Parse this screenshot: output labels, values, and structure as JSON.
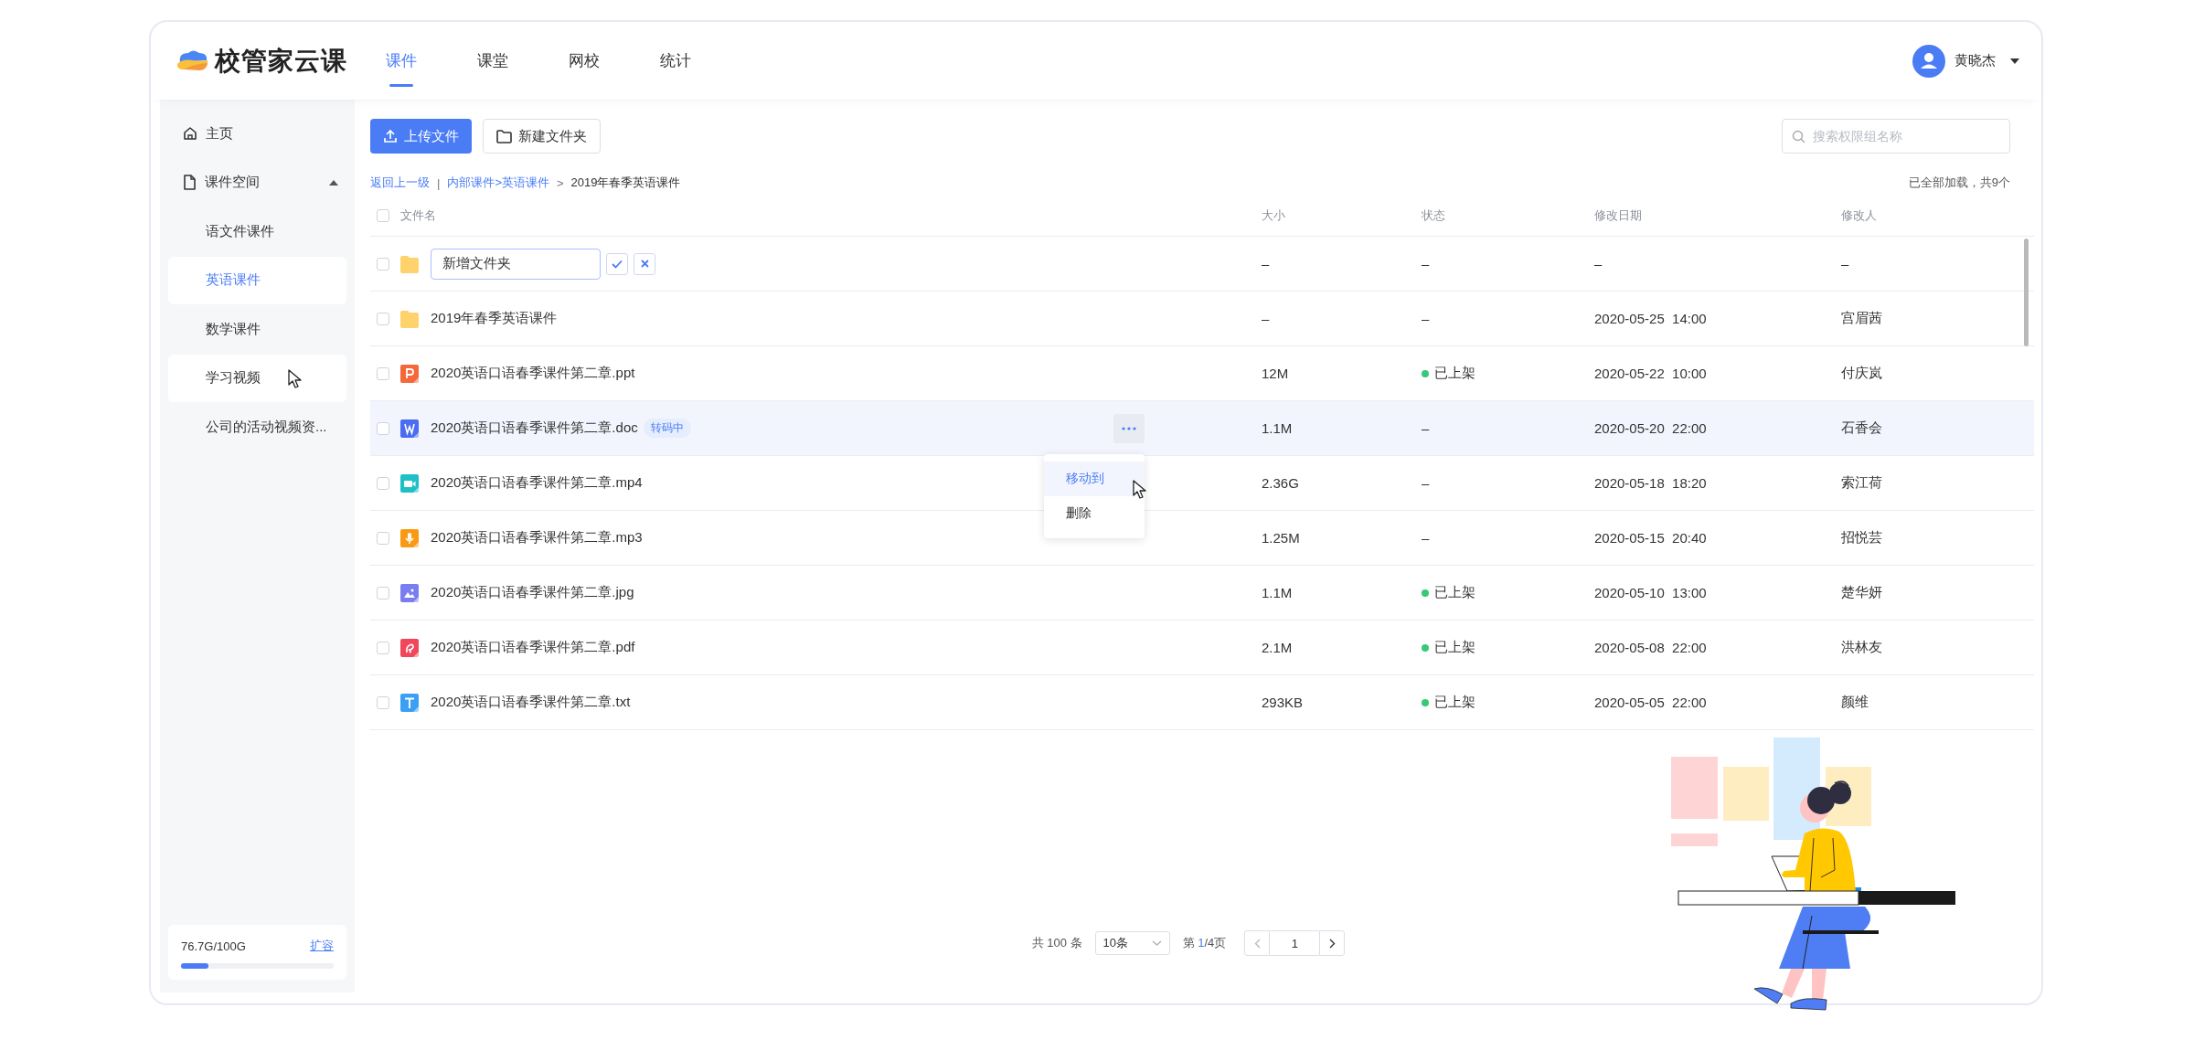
{
  "logo": {
    "text": "校管家云课"
  },
  "nav_tabs": [
    {
      "label": "课件",
      "selected": true
    },
    {
      "label": "课堂",
      "selected": false
    },
    {
      "label": "网校",
      "selected": false
    },
    {
      "label": "统计",
      "selected": false
    }
  ],
  "user": {
    "name": "黄晓杰"
  },
  "sidebar": {
    "items": [
      {
        "label": "主页",
        "selected": false
      },
      {
        "label": "课件空间",
        "selected": false,
        "expanded": true,
        "children": [
          {
            "label": "语文件课件",
            "selected": false,
            "hovered": false
          },
          {
            "label": "英语课件",
            "selected": true,
            "hovered": false
          },
          {
            "label": "数学课件",
            "selected": false,
            "hovered": false
          },
          {
            "label": "学习视频",
            "selected": false,
            "hovered": true
          },
          {
            "label": "公司的活动视频资...",
            "selected": false,
            "hovered": false
          }
        ]
      }
    ],
    "storage": {
      "usage": "76.7G/100G",
      "level": 0.18,
      "action": "扩容"
    }
  },
  "toolbar": {
    "buttons": [
      {
        "label": "上传文件",
        "kind": "primary"
      },
      {
        "label": "新建文件夹",
        "kind": "default"
      }
    ],
    "search": {
      "placeholder": "搜索权限组名称"
    }
  },
  "breadcrumb": {
    "back": "返回上一级",
    "separator": "|",
    "path": "内部课件>英语课件",
    "arrow": ">",
    "current": "2019年春季英语课件"
  },
  "load_status": "已全部加载，共9个",
  "table": {
    "all_checked": false,
    "columns": [
      "文件名",
      "大小",
      "状态",
      "修改日期",
      "修改人"
    ],
    "rows": [
      {
        "kind": "new-folder",
        "name": "新增文件夹",
        "size": "–",
        "status": "–",
        "published": false,
        "modified": "–",
        "editor": "–",
        "checked": false,
        "hovered": false
      },
      {
        "kind": "folder",
        "name": "2019年春季英语课件",
        "size": "–",
        "status": "–",
        "published": false,
        "modified": "2020-05-25  14:00",
        "editor": "宫眉茜",
        "checked": false,
        "hovered": false
      },
      {
        "kind": "ppt",
        "name": "2020英语口语春季课件第二章.ppt",
        "size": "12M",
        "status": "已上架",
        "published": true,
        "modified": "2020-05-22  10:00",
        "editor": "付庆岚",
        "checked": false,
        "hovered": false
      },
      {
        "kind": "doc",
        "name": "2020英语口语春季课件第二章.doc",
        "tag": "转码中",
        "size": "1.1M",
        "status": "–",
        "published": false,
        "modified": "2020-05-20  22:00",
        "editor": "石香会",
        "checked": false,
        "hovered": true,
        "menu": {
          "items": [
            {
              "label": "移动到",
              "selected": true
            },
            {
              "label": "删除",
              "selected": false
            }
          ]
        }
      },
      {
        "kind": "mp4",
        "name": "2020英语口语春季课件第二章.mp4",
        "size": "2.36G",
        "status": "–",
        "published": false,
        "modified": "2020-05-18  18:20",
        "editor": "索江荷",
        "checked": false,
        "hovered": false
      },
      {
        "kind": "mp3",
        "name": "2020英语口语春季课件第二章.mp3",
        "size": "1.25M",
        "status": "–",
        "published": false,
        "modified": "2020-05-15  20:40",
        "editor": "招悦芸",
        "checked": false,
        "hovered": false
      },
      {
        "kind": "jpg",
        "name": "2020英语口语春季课件第二章.jpg",
        "size": "1.1M",
        "status": "已上架",
        "published": true,
        "modified": "2020-05-10  13:00",
        "editor": "楚华妍",
        "checked": false,
        "hovered": false
      },
      {
        "kind": "pdf",
        "name": "2020英语口语春季课件第二章.pdf",
        "size": "2.1M",
        "status": "已上架",
        "published": true,
        "modified": "2020-05-08  22:00",
        "editor": "洪林友",
        "checked": false,
        "hovered": false
      },
      {
        "kind": "txt",
        "name": "2020英语口语春季课件第二章.txt",
        "size": "293KB",
        "status": "已上架",
        "published": true,
        "modified": "2020-05-05  22:00",
        "editor": "颜维",
        "checked": false,
        "hovered": false
      }
    ]
  },
  "pagination": {
    "total": "共 100 条",
    "page_size": "10条",
    "page_prefix": "第 ",
    "page_current": "1",
    "page_suffix": "/4页",
    "jump_value": "1"
  }
}
